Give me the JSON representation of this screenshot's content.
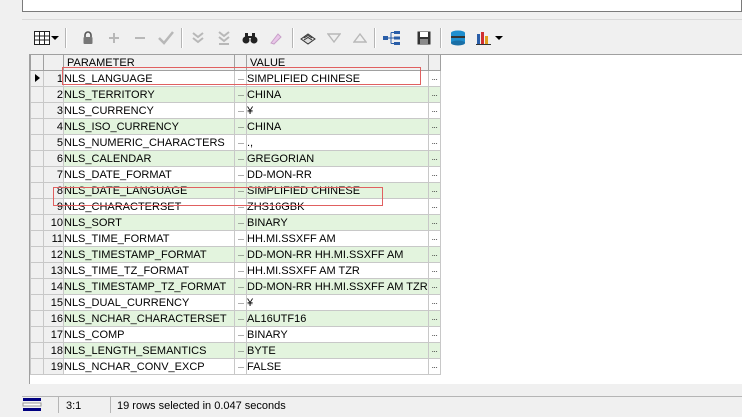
{
  "toolbar": {
    "icons": [
      "grid-view-icon",
      "dropdown-arrow-icon",
      "lock-icon",
      "add-record-icon",
      "delete-record-icon",
      "post-changes-icon",
      "fetch-next-page-icon",
      "fetch-all-icon",
      "find-icon",
      "clear-icon",
      "print-icon",
      "filter-icon",
      "sort-icon",
      "tree-icon",
      "save-icon",
      "export-icon",
      "chart-icon",
      "chart-dropdown-icon"
    ]
  },
  "grid": {
    "columns": [
      "PARAMETER",
      "VALUE"
    ],
    "rows": [
      {
        "num": "1",
        "param": "NLS_LANGUAGE",
        "value": "SIMPLIFIED CHINESE"
      },
      {
        "num": "2",
        "param": "NLS_TERRITORY",
        "value": "CHINA"
      },
      {
        "num": "3",
        "param": "NLS_CURRENCY",
        "value": "¥"
      },
      {
        "num": "4",
        "param": "NLS_ISO_CURRENCY",
        "value": "CHINA"
      },
      {
        "num": "5",
        "param": "NLS_NUMERIC_CHARACTERS",
        "value": ".,"
      },
      {
        "num": "6",
        "param": "NLS_CALENDAR",
        "value": "GREGORIAN"
      },
      {
        "num": "7",
        "param": "NLS_DATE_FORMAT",
        "value": "DD-MON-RR"
      },
      {
        "num": "8",
        "param": "NLS_DATE_LANGUAGE",
        "value": "SIMPLIFIED CHINESE"
      },
      {
        "num": "9",
        "param": "NLS_CHARACTERSET",
        "value": "ZHS16GBK"
      },
      {
        "num": "10",
        "param": "NLS_SORT",
        "value": "BINARY"
      },
      {
        "num": "11",
        "param": "NLS_TIME_FORMAT",
        "value": "HH.MI.SSXFF AM"
      },
      {
        "num": "12",
        "param": "NLS_TIMESTAMP_FORMAT",
        "value": "DD-MON-RR HH.MI.SSXFF AM"
      },
      {
        "num": "13",
        "param": "NLS_TIME_TZ_FORMAT",
        "value": "HH.MI.SSXFF AM TZR"
      },
      {
        "num": "14",
        "param": "NLS_TIMESTAMP_TZ_FORMAT",
        "value": "DD-MON-RR HH.MI.SSXFF AM TZR"
      },
      {
        "num": "15",
        "param": "NLS_DUAL_CURRENCY",
        "value": "¥"
      },
      {
        "num": "16",
        "param": "NLS_NCHAR_CHARACTERSET",
        "value": "AL16UTF16"
      },
      {
        "num": "17",
        "param": "NLS_COMP",
        "value": "BINARY"
      },
      {
        "num": "18",
        "param": "NLS_LENGTH_SEMANTICS",
        "value": "BYTE"
      },
      {
        "num": "19",
        "param": "NLS_NCHAR_CONV_EXCP",
        "value": "FALSE"
      }
    ],
    "ellipsis": "···"
  },
  "status": {
    "position": "3:1",
    "message": "19 rows selected in 0.047 seconds"
  },
  "colors": {
    "alt_row": "#e3f4de",
    "highlight": "#e06060"
  }
}
